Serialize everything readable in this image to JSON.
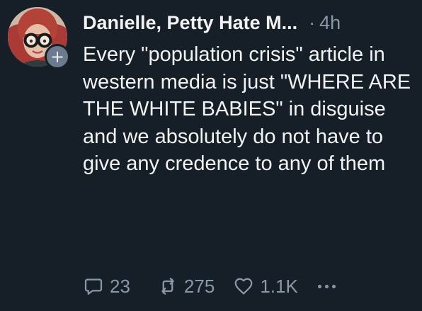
{
  "post": {
    "author": "Danielle, Petty Hate M...",
    "separator": "·",
    "time": "4h",
    "text": "Every \"population crisis\" article in western media is just \"WHERE ARE THE WHITE BABIES\" in disguise and we absolutely do not have to give any credence to any of them",
    "follow_badge": "+",
    "actions": {
      "replies": "23",
      "reposts": "275",
      "likes": "1.1K"
    },
    "icons": {
      "reply": "speech-bubble-icon",
      "repost": "repost-arrows-icon",
      "like": "heart-icon",
      "more": "more-dots-icon"
    }
  }
}
